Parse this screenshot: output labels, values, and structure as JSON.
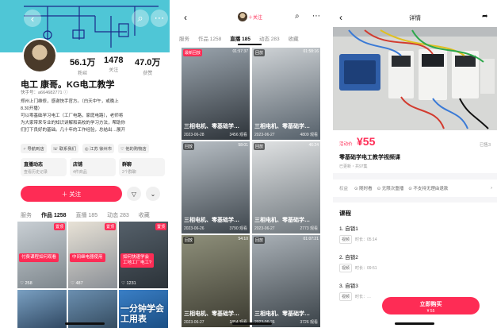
{
  "profile": {
    "stats": [
      {
        "num": "56.1万",
        "label": "粉丝"
      },
      {
        "num": "1478",
        "label": "关注"
      },
      {
        "num": "47.0万",
        "label": "获赞"
      }
    ],
    "name": "电工 康哥。KG电工教学",
    "uid": "快手号：a664682771 ⓘ",
    "bio_lines": [
      "郑州上门维修，感谢快手官方。（白天中午，或晚上",
      "8.30开播）",
      "可以零基础学习电工（工厂电路，家庭电路），老师将",
      "为大家带来专业的知识讲解和高校的学习方法，帮助你",
      "们打下良好的基础。几十年的工作经验，总结出…展开"
    ],
    "tags": [
      "♂ 导航到店",
      "☏ 联系我们",
      "◎ 江苏 徐州市",
      "♡ 他的购物店"
    ],
    "cards": [
      {
        "title": "直播动态",
        "sub": "查看历史记录"
      },
      {
        "title": "店铺",
        "sub": "4件商品"
      },
      {
        "title": "群聊",
        "sub": "2个群聊"
      }
    ],
    "follow_label": "＋ 关注",
    "tabs": [
      "服务",
      "作品 1258",
      "直播 185",
      "动态 283",
      "收藏"
    ],
    "thumbs": [
      {
        "badge": "置顶",
        "caption": "付费课程如何观看",
        "likes": "♡ 258"
      },
      {
        "badge": "置顶",
        "caption": "中间继电器使用",
        "likes": "♡ 487"
      },
      {
        "badge": "置顶",
        "caption": "如何快速学会\n工地工厂电工?",
        "likes": "♡ 1231"
      },
      {
        "badge": "",
        "caption": "",
        "likes": ""
      },
      {
        "badge": "",
        "caption": "",
        "likes": ""
      },
      {
        "badge": "",
        "big": "一分钟学会\n工用表",
        "likes": ""
      }
    ]
  },
  "live": {
    "follow_label": "＋关注",
    "tabs": [
      "服务",
      "作品 1258",
      "直播 185",
      "动态 283",
      "收藏"
    ],
    "videos": [
      {
        "tag": "最新回放",
        "dur": "01:57:37",
        "title": "三相电机、零基础学…",
        "date": "2023-06-28",
        "views": "3456 观看"
      },
      {
        "tag": "回放",
        "dur": "01:58:16",
        "title": "三相电机、零基础学…",
        "date": "2023-06-27",
        "views": "4809 观看"
      },
      {
        "tag": "回放",
        "dur": "58:01",
        "title": "三相电机、零基础学…",
        "date": "2023-06-26",
        "views": "3790 观看"
      },
      {
        "tag": "回放",
        "dur": "46:24",
        "title": "三相电机、零基础学…",
        "date": "2023-06-27",
        "views": "2773 观看"
      },
      {
        "tag": "回放",
        "dur": "54:10",
        "title": "三相电机、零基础学…",
        "date": "2023-06-27",
        "views": "1854 观看"
      },
      {
        "tag": "回放",
        "dur": "01:07:21",
        "title": "三相电机、零基础学…",
        "date": "2023-06-26",
        "views": "3726 观看"
      }
    ]
  },
  "detail": {
    "title": "详情",
    "price_tag": "活动价",
    "price": "¥55",
    "sold": "已售3",
    "product_title": "零基础学电工教学视频课",
    "product_sub": "已更新・共97集",
    "rights_key": "权益",
    "rights": [
      "⊙ 随时看",
      "⊙ 无限次重播",
      "⊙ 不支持无理由退款"
    ],
    "course_title": "课程",
    "lessons": [
      {
        "title": "1. 自锁1",
        "pill": "视频",
        "duration": "时长：05:14"
      },
      {
        "title": "2. 自锁2",
        "pill": "视频",
        "duration": "时长：09:51"
      },
      {
        "title": "3. 自锁3",
        "pill": "视频",
        "duration": "时长：…"
      }
    ],
    "buy_label": "立即购买",
    "buy_price": "¥ 55"
  }
}
